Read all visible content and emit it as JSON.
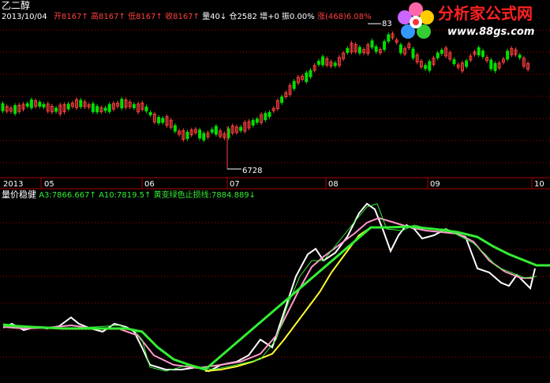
{
  "stock_name": "乙二醇",
  "date": "2013/10/04",
  "colors": {
    "background": "#000000",
    "up": "#ff4040",
    "down": "#00e000",
    "white_line": "#ffffff",
    "pink_line": "#ff99cc",
    "yellow_line": "#ffff33",
    "green_line": "#33ee33",
    "thin_green_line": "#33ee33",
    "axis": "#aa0000",
    "brand": "#ff2222"
  },
  "quote": {
    "open_label": "开",
    "open": "8167",
    "high_label": "高",
    "high": "8167",
    "low_label": "低",
    "low": "8167",
    "close_label": "收",
    "close": "8167",
    "volume_label": "量",
    "volume": "40",
    "position_label": "仓",
    "position": "2582",
    "increase_label": "增",
    "increase": "+0",
    "amplitude_label": "振",
    "amplitude": "0.00%",
    "change_label": "涨",
    "change": "(468)",
    "change_pct": "6.08%",
    "arrow_up": "↑",
    "arrow_down": "↓"
  },
  "annotations": {
    "high_label": "83",
    "low_label": "6728"
  },
  "time_axis": {
    "labels": [
      "2013",
      "05",
      "06",
      "07",
      "08",
      "09",
      "10"
    ]
  },
  "indicator": {
    "name": "量价稳健",
    "a3_label": "A3:",
    "a3_value": "7866.667",
    "a10_label": "A10:",
    "a10_value": "7819.5",
    "signal_label": "黄变绿色止损线:",
    "signal_value": "7884.889",
    "arrow_up": "↑",
    "arrow_down": "↓"
  },
  "logo": {
    "title": "分析家公式网",
    "url": "www.88gs.com"
  }
}
